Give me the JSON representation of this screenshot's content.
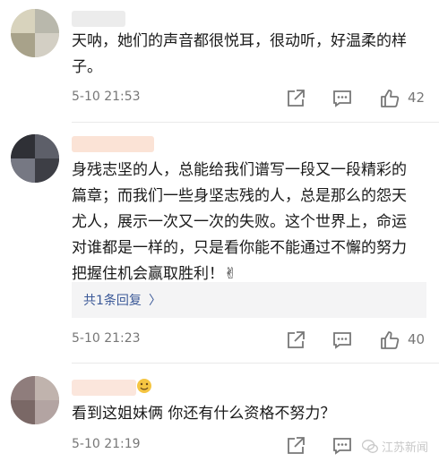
{
  "comments": [
    {
      "text": "天呐，她们的声音都很悦耳，很动听，好温柔的样子。",
      "time": "5-10 21:53",
      "like_count": "42"
    },
    {
      "text": "身残志坚的人，总能给我们谱写一段又一段精彩的篇章；而我们一些身坚志残的人，总是那么的怨天尤人，展示一次又一次的失败。这个世界上，命运对谁都是一样的，只是看你能不能通过不懈的努力把握住机会赢取胜利！✌",
      "time": "5-10 21:23",
      "like_count": "40",
      "reply_label": "共1条回复",
      "reply_chevron": "〉"
    },
    {
      "text": "看到这姐妹俩 你还有什么资格不努力？",
      "time": "5-10 21:19"
    }
  ],
  "watermark": {
    "text": "江苏新闻",
    "icon": "wechat-icon"
  },
  "colors": {
    "meta": "#777777",
    "link": "#3b5998",
    "reply_bg": "#f4f4f5"
  }
}
